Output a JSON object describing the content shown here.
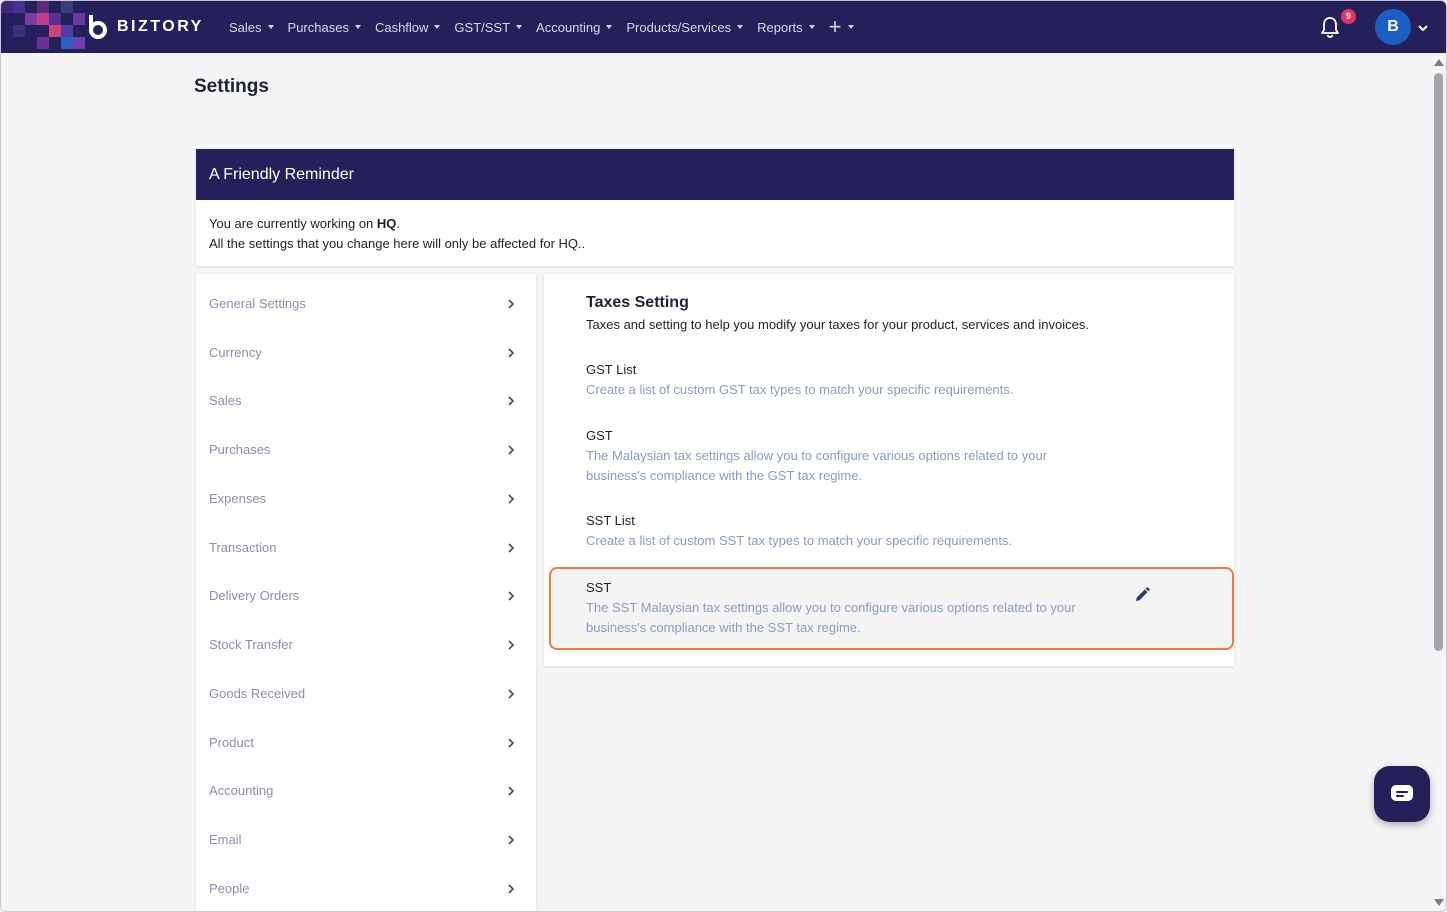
{
  "brand": {
    "name": "BIZTORY",
    "accent": "#24215a"
  },
  "nav": {
    "items": [
      {
        "label": "Sales"
      },
      {
        "label": "Purchases"
      },
      {
        "label": "Cashflow"
      },
      {
        "label": "GST/SST"
      },
      {
        "label": "Accounting"
      },
      {
        "label": "Products/Services"
      },
      {
        "label": "Reports"
      }
    ],
    "add_icon": "plus-icon"
  },
  "notifications": {
    "count": "9",
    "icon": "bell-icon"
  },
  "user": {
    "initial": "B"
  },
  "page": {
    "title": "Settings"
  },
  "reminder": {
    "title": "A Friendly Reminder",
    "line1_prefix": "You are currently working on ",
    "line1_entity": "HQ",
    "line1_suffix": ".",
    "line2": "All the settings that you change here will only be affected for HQ.."
  },
  "sidebar": {
    "items": [
      {
        "label": "General Settings"
      },
      {
        "label": "Currency"
      },
      {
        "label": "Sales"
      },
      {
        "label": "Purchases"
      },
      {
        "label": "Expenses"
      },
      {
        "label": "Transaction"
      },
      {
        "label": "Delivery Orders"
      },
      {
        "label": "Stock Transfer"
      },
      {
        "label": "Goods Received"
      },
      {
        "label": "Product"
      },
      {
        "label": "Accounting"
      },
      {
        "label": "Email"
      },
      {
        "label": "People"
      }
    ]
  },
  "taxes": {
    "title": "Taxes Setting",
    "subtitle": "Taxes and setting to help you modify your taxes for your product, services and invoices.",
    "items": [
      {
        "name": "GST List",
        "desc": "Create a list of custom GST tax types to match your specific requirements."
      },
      {
        "name": "GST",
        "desc1": "The Malaysian tax settings allow you to configure various options related to your",
        "desc2": "business's compliance with the GST tax regime."
      },
      {
        "name": "SST List",
        "desc": "Create a list of custom SST tax types to match your specific requirements."
      },
      {
        "name": "SST",
        "desc1": "The SST Malaysian tax settings allow you to configure various options related to your",
        "desc2": "business's compliance with the SST tax regime."
      }
    ],
    "highlight_color": "#f07a3e"
  }
}
